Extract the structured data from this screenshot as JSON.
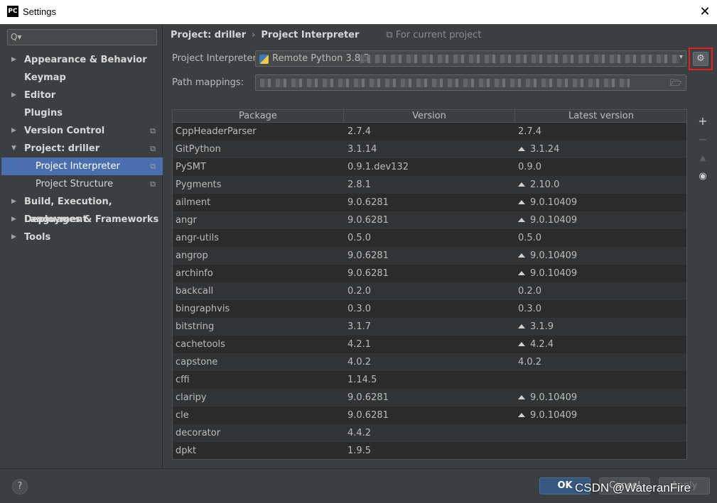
{
  "window": {
    "title": "Settings",
    "app_logo": "PC",
    "close_glyph": "✕"
  },
  "sidebar": {
    "search_icon": "Q▾",
    "items": [
      {
        "label": "Appearance & Behavior",
        "arrow": "▶",
        "level": 0,
        "copy": ""
      },
      {
        "label": "Keymap",
        "arrow": "",
        "level": 0,
        "copy": ""
      },
      {
        "label": "Editor",
        "arrow": "▶",
        "level": 0,
        "copy": ""
      },
      {
        "label": "Plugins",
        "arrow": "",
        "level": 0,
        "copy": ""
      },
      {
        "label": "Version Control",
        "arrow": "▶",
        "level": 0,
        "copy": "⧉"
      },
      {
        "label": "Project: driller",
        "arrow": "▼",
        "level": 0,
        "copy": "⧉"
      },
      {
        "label": "Project Interpreter",
        "arrow": "",
        "level": 1,
        "copy": "⧉",
        "selected": true
      },
      {
        "label": "Project Structure",
        "arrow": "",
        "level": 1,
        "copy": "⧉"
      },
      {
        "label": "Build, Execution, Deployment",
        "arrow": "▶",
        "level": 0,
        "copy": ""
      },
      {
        "label": "Languages & Frameworks",
        "arrow": "▶",
        "level": 0,
        "copy": ""
      },
      {
        "label": "Tools",
        "arrow": "▶",
        "level": 0,
        "copy": ""
      }
    ]
  },
  "breadcrumb": {
    "project": "Project: driller",
    "separator": "›",
    "page": "Project Interpreter",
    "scope": "⧉ For current project"
  },
  "interpreter": {
    "label": "Project Interpreter:",
    "value": "Remote Python 3.8.5",
    "dropdown": "▾"
  },
  "path_mappings": {
    "label": "Path mappings:",
    "folder_icon": "🗁"
  },
  "gear_icon": "⚙",
  "table": {
    "columns": [
      "Package",
      "Version",
      "Latest version"
    ],
    "rows": [
      {
        "package": "CppHeaderParser",
        "version": "2.7.4",
        "latest": "2.7.4",
        "upgrade": false
      },
      {
        "package": "GitPython",
        "version": "3.1.14",
        "latest": "3.1.24",
        "upgrade": true
      },
      {
        "package": "PySMT",
        "version": "0.9.1.dev132",
        "latest": "0.9.0",
        "upgrade": false
      },
      {
        "package": "Pygments",
        "version": "2.8.1",
        "latest": "2.10.0",
        "upgrade": true
      },
      {
        "package": "ailment",
        "version": "9.0.6281",
        "latest": "9.0.10409",
        "upgrade": true
      },
      {
        "package": "angr",
        "version": "9.0.6281",
        "latest": "9.0.10409",
        "upgrade": true
      },
      {
        "package": "angr-utils",
        "version": "0.5.0",
        "latest": "0.5.0",
        "upgrade": false
      },
      {
        "package": "angrop",
        "version": "9.0.6281",
        "latest": "9.0.10409",
        "upgrade": true
      },
      {
        "package": "archinfo",
        "version": "9.0.6281",
        "latest": "9.0.10409",
        "upgrade": true
      },
      {
        "package": "backcall",
        "version": "0.2.0",
        "latest": "0.2.0",
        "upgrade": false
      },
      {
        "package": "bingraphvis",
        "version": "0.3.0",
        "latest": "0.3.0",
        "upgrade": false
      },
      {
        "package": "bitstring",
        "version": "3.1.7",
        "latest": "3.1.9",
        "upgrade": true
      },
      {
        "package": "cachetools",
        "version": "4.2.1",
        "latest": "4.2.4",
        "upgrade": true
      },
      {
        "package": "capstone",
        "version": "4.0.2",
        "latest": "4.0.2",
        "upgrade": false
      },
      {
        "package": "cffi",
        "version": "1.14.5",
        "latest": "",
        "upgrade": false
      },
      {
        "package": "claripy",
        "version": "9.0.6281",
        "latest": "9.0.10409",
        "upgrade": true
      },
      {
        "package": "cle",
        "version": "9.0.6281",
        "latest": "9.0.10409",
        "upgrade": true
      },
      {
        "package": "decorator",
        "version": "4.4.2",
        "latest": "",
        "upgrade": false
      },
      {
        "package": "dpkt",
        "version": "1.9.5",
        "latest": "",
        "upgrade": false
      }
    ]
  },
  "tools": {
    "add": "+",
    "remove": "−",
    "upgrade": "▲",
    "show": "◉"
  },
  "footer": {
    "help": "?",
    "ok": "OK",
    "cancel": "Cancel",
    "apply": "Apply",
    "watermark": "CSDN @WateranFire"
  }
}
